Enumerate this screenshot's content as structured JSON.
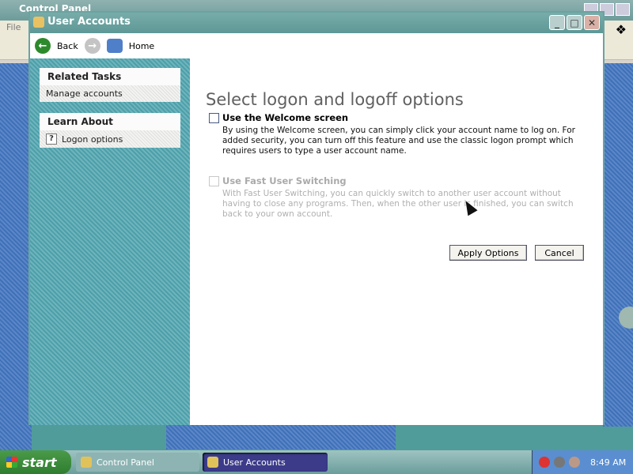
{
  "background_window": {
    "title": "Control Panel",
    "menu_first": "File"
  },
  "window": {
    "title": "User Accounts",
    "buttons": {
      "minimize": "_",
      "maximize": "□",
      "close": "✕"
    }
  },
  "toolbar": {
    "back_label": "Back",
    "home_label": "Home"
  },
  "sidebar": {
    "related_tasks": {
      "header": "Related Tasks",
      "items": [
        {
          "label": "Manage accounts"
        }
      ]
    },
    "learn_about": {
      "header": "Learn About",
      "items": [
        {
          "label": "Logon options",
          "icon": "help-icon"
        }
      ]
    }
  },
  "main": {
    "title": "Select logon and logoff options",
    "options": [
      {
        "label": "Use the Welcome screen",
        "checked": false,
        "enabled": true,
        "description": "By using the Welcome screen, you can simply click your account name to log on. For added security, you can turn off this feature and use the classic logon prompt which requires users to type a user account name."
      },
      {
        "label": "Use Fast User Switching",
        "checked": false,
        "enabled": false,
        "description": "With Fast User Switching, you can quickly switch to another user account without having to close any programs. Then, when the other user is finished, you can switch back to your own account."
      }
    ],
    "apply_label": "Apply Options",
    "cancel_label": "Cancel"
  },
  "taskbar": {
    "start_label": "start",
    "tasks": [
      {
        "label": "Control Panel",
        "active": false
      },
      {
        "label": "User Accounts",
        "active": true
      }
    ],
    "clock": "8:49 AM"
  },
  "colors": {
    "titlebar": "#6aa3a1",
    "sidebar": "#5aa8b0",
    "taskbar_active": "#3b3b8a"
  }
}
